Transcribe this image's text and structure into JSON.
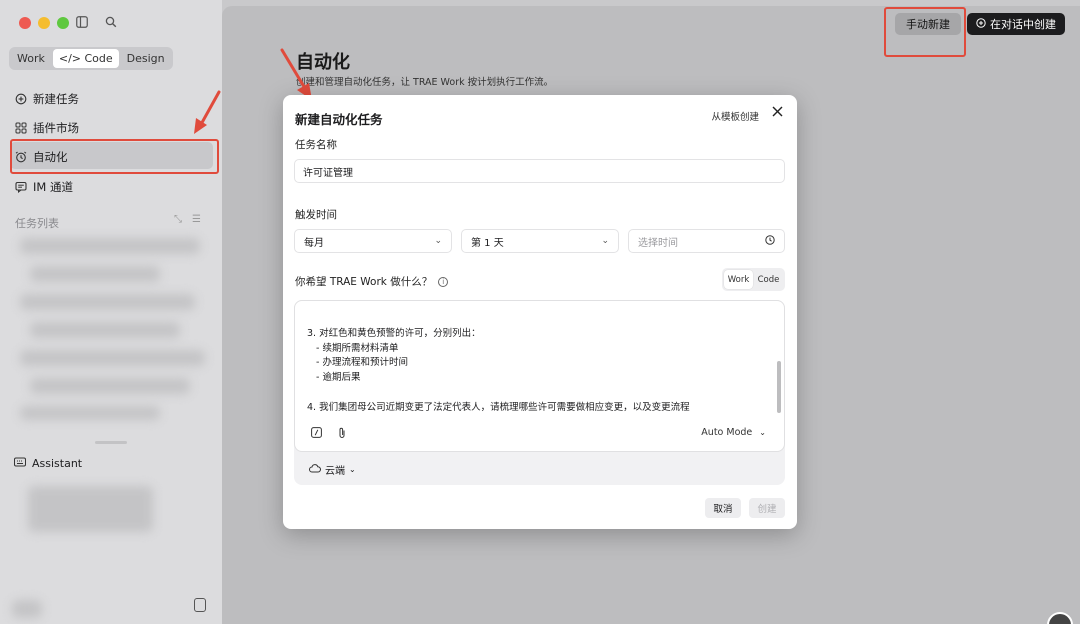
{
  "sidebar": {
    "segments": [
      "Work",
      "</> Code",
      "Design"
    ],
    "active_segment": "</> Code",
    "nav": [
      {
        "label": "新建任务",
        "icon": "new-task-icon"
      },
      {
        "label": "插件市场",
        "icon": "plugin-grid-icon"
      },
      {
        "label": "自动化",
        "icon": "alarm-clock-icon"
      },
      {
        "label": "IM 通道",
        "icon": "chat-bubble-icon"
      }
    ],
    "task_list_title": "任务列表",
    "assistant_label": "Assistant"
  },
  "header": {
    "manual_new": "手动新建",
    "create_in_chat": "在对话中创建"
  },
  "page": {
    "title": "自动化",
    "subtitle": "创建和管理自动化任务，让 TRAE Work 按计划执行工作流。"
  },
  "modal": {
    "title": "新建自动化任务",
    "from_template": "从模板创建",
    "task_name_label": "任务名称",
    "task_name_value": "许可证管理",
    "trigger_label": "触发时间",
    "frequency": "每月",
    "day": "第 1 天",
    "time_placeholder": "选择时间",
    "prompt_label": "你希望 TRAE Work 做什么？",
    "mode_toggle": [
      "Work",
      "Code"
    ],
    "active_mode_toggle": "Work",
    "prompt_lines": [
      "3. 对红色和黄色预警的许可，分别列出：",
      "   - 续期所需材料清单",
      "   - 办理流程和预计时间",
      "   - 逾期后果",
      "",
      "4. 我们集团母公司近期变更了法定代表人，请梳理哪些许可需要做相应变更，以及变更流程"
    ],
    "agent_mode": "Auto Mode",
    "runtime": "云端",
    "cancel": "取消",
    "create": "创建"
  },
  "colors": {
    "annotation_red": "#e04b3c",
    "primary_dark": "#1c1c1e"
  }
}
